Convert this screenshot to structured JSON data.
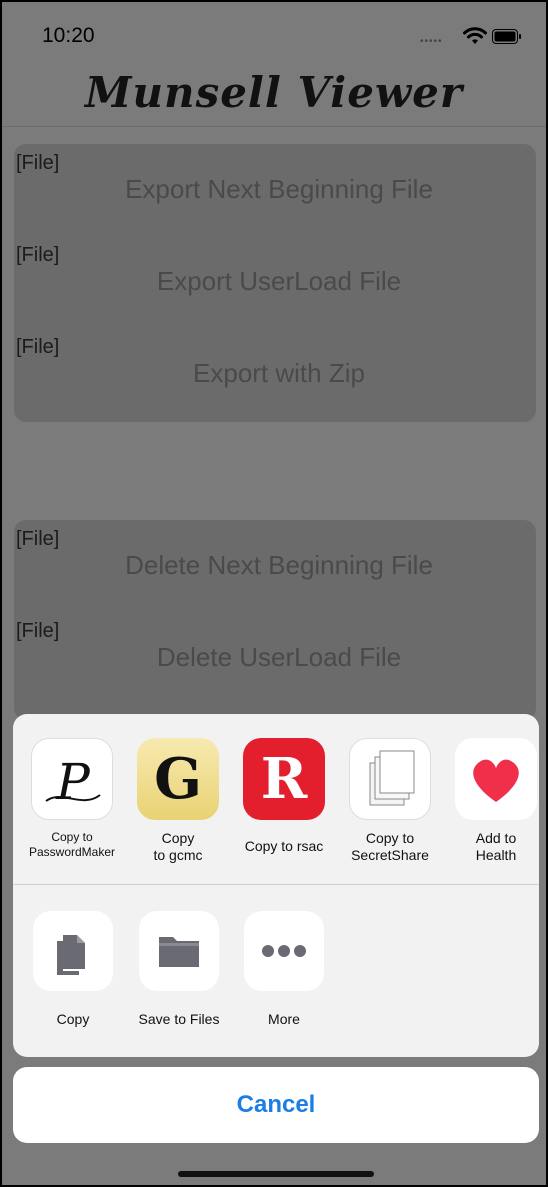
{
  "status": {
    "time": "10:20"
  },
  "app_title": "Munsell Viewer",
  "export_group": [
    {
      "tag": "[File]",
      "label": "Export Next Beginning File"
    },
    {
      "tag": "[File]",
      "label": "Export UserLoad File"
    },
    {
      "tag": "[File]",
      "label": "Export with Zip"
    }
  ],
  "delete_group": [
    {
      "tag": "[File]",
      "label": "Delete Next Beginning File"
    },
    {
      "tag": "[File]",
      "label": "Delete UserLoad File"
    }
  ],
  "share_sheet": {
    "apps": [
      {
        "label": "Copy to\nPasswordMaker",
        "icon": "passwordmaker-icon"
      },
      {
        "label": "Copy\nto gcmc",
        "icon": "gcmc-icon",
        "glyph": "G"
      },
      {
        "label": "Copy to rsac",
        "icon": "rsac-icon",
        "glyph": "R"
      },
      {
        "label": "Copy to\nSecretShare",
        "icon": "secretshare-icon"
      },
      {
        "label": "Add to\nHealth",
        "icon": "health-icon"
      }
    ],
    "actions": [
      {
        "label": "Copy",
        "icon": "copy-icon"
      },
      {
        "label": "Save to Files",
        "icon": "folder-icon"
      },
      {
        "label": "More",
        "icon": "more-icon"
      }
    ],
    "cancel_label": "Cancel"
  },
  "colors": {
    "accent": "#1a7ee6",
    "rsac": "#e31e2d",
    "health": "#f0304a"
  }
}
